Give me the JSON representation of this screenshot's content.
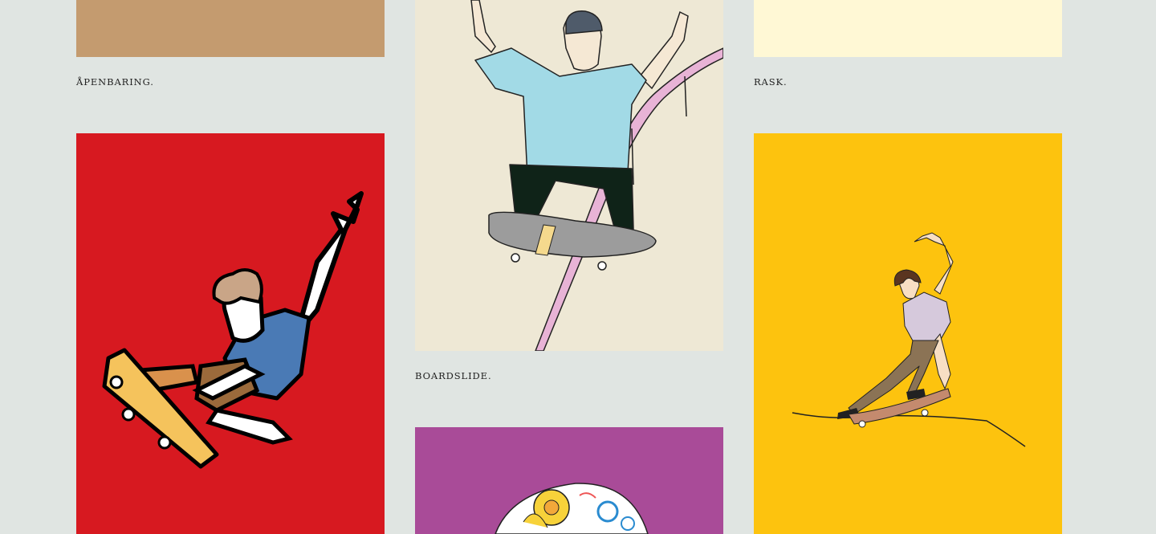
{
  "gallery": {
    "items": [
      {
        "caption": "ÅPENBARING.",
        "color": "#c49b6f"
      },
      {
        "caption": "BOARDSLIDE.",
        "color": "#eee8d5"
      },
      {
        "caption": "RASK.",
        "color": "#fff8d5"
      },
      {
        "caption": "",
        "color": "#d71920"
      },
      {
        "caption": "",
        "color": "#a94b98"
      },
      {
        "caption": "",
        "color": "#fdc30e"
      }
    ]
  },
  "colors": {
    "page_background": "#e0e5e2",
    "caption_text": "#222222"
  }
}
